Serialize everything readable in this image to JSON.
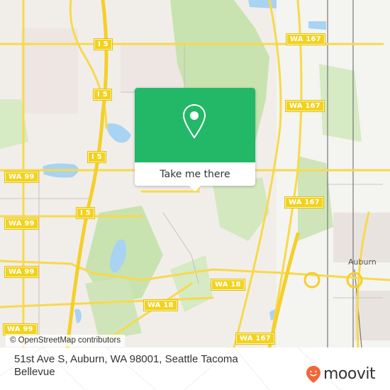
{
  "map": {
    "shields": [
      {
        "label": "I 5",
        "id": "i5-a"
      },
      {
        "label": "I 5",
        "id": "i5-b"
      },
      {
        "label": "I 5",
        "id": "i5-c"
      },
      {
        "label": "I 5",
        "id": "i5-d"
      },
      {
        "label": "WA 167",
        "id": "wa167-a"
      },
      {
        "label": "WA 167",
        "id": "wa167-b"
      },
      {
        "label": "WA 167",
        "id": "wa167-c"
      },
      {
        "label": "WA 167",
        "id": "wa167-d"
      },
      {
        "label": "WA 99",
        "id": "wa99-a"
      },
      {
        "label": "WA 99",
        "id": "wa99-b"
      },
      {
        "label": "WA 99",
        "id": "wa99-c"
      },
      {
        "label": "WA 99",
        "id": "wa99-d"
      },
      {
        "label": "WA 18",
        "id": "wa18-a"
      },
      {
        "label": "WA 18",
        "id": "wa18-b"
      }
    ],
    "place_labels": {
      "auburn": "Auburn"
    },
    "attribution": "© OpenStreetMap contributors"
  },
  "popup": {
    "icon": "map-pin-icon",
    "button_label": "Take me there",
    "color": "#22b867"
  },
  "footer": {
    "address": "51st Ave S, Auburn, WA 98001, Seattle Tacoma Bellevue",
    "brand": "moovit",
    "brand_color": "#f0683a"
  }
}
